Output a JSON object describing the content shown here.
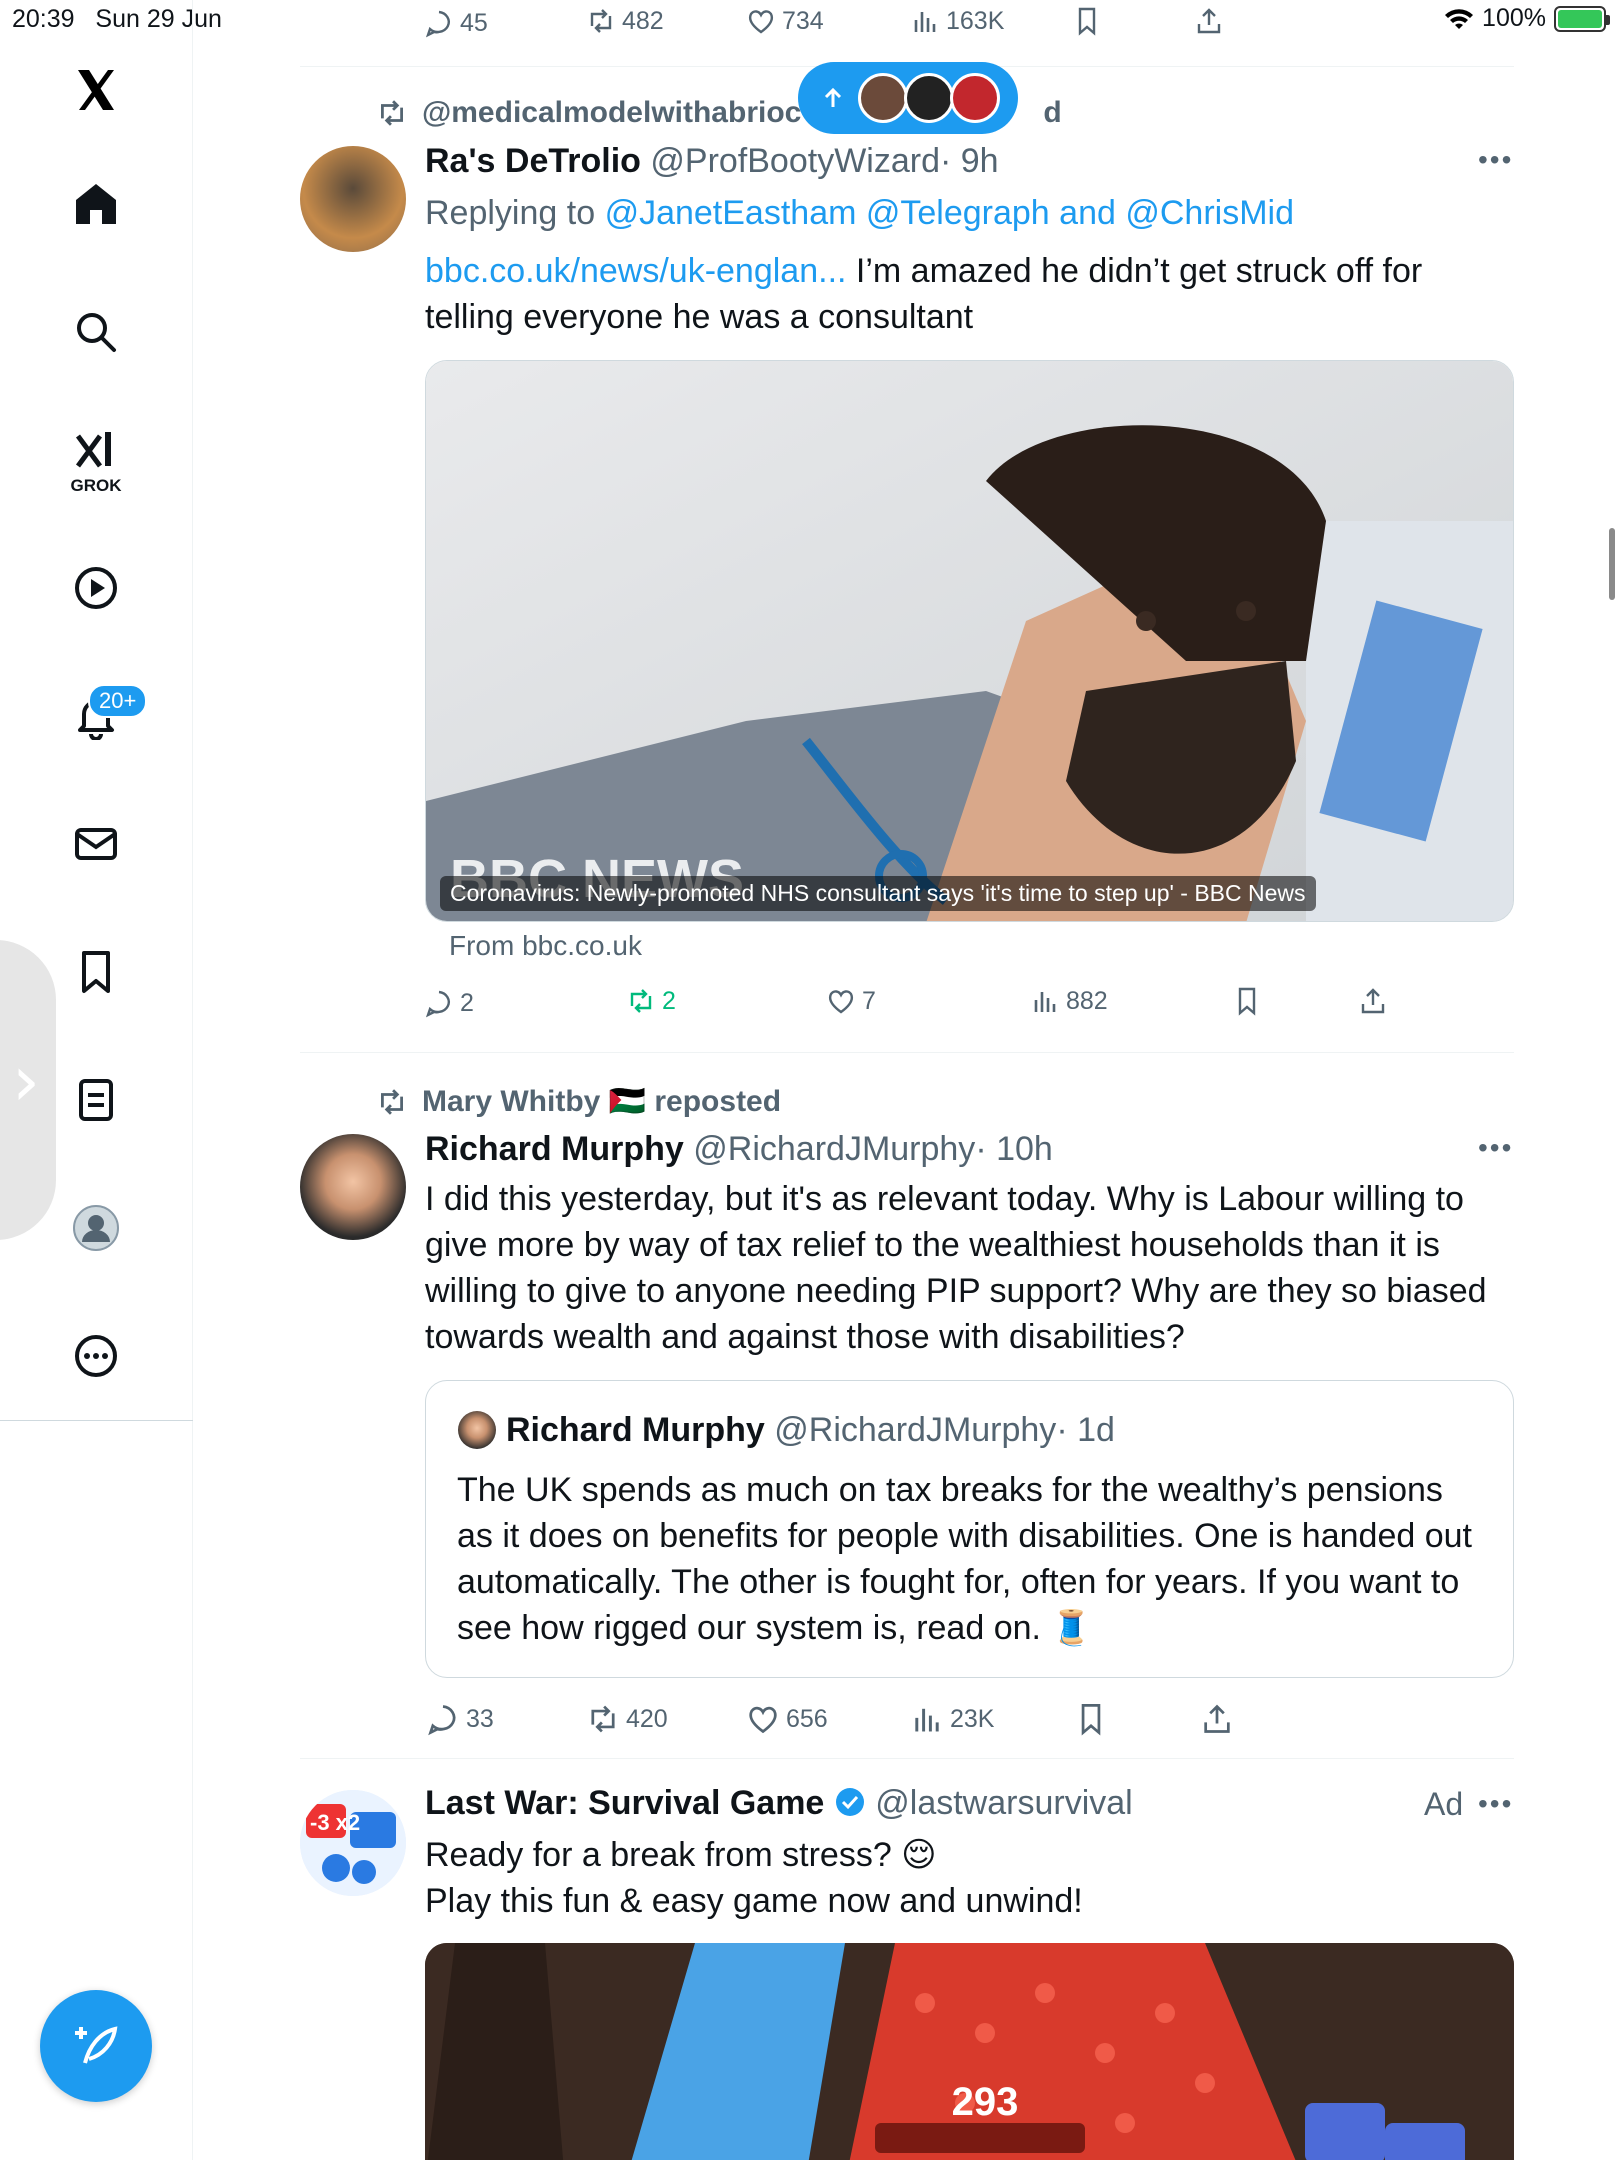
{
  "status_bar": {
    "time": "20:39",
    "date": "Sun 29 Jun",
    "battery": "100%"
  },
  "sidebar": {
    "grok_label": "GROK",
    "notification_badge": "20+"
  },
  "top_metrics": {
    "replies": "45",
    "reposts": "482",
    "likes": "734",
    "views": "163K"
  },
  "tweet1": {
    "reposted_by": "@medicalmodelwithabrioc",
    "reposted_tail": "d",
    "name": "Ra's DeTrolio",
    "handle": "@ProfBootyWizard",
    "time": "· 9h",
    "replying_prefix": "Replying to",
    "replying_to": "@JanetEastham @Telegraph and @ChrisMid",
    "link": "bbc.co.uk/news/uk-englan...",
    "text_line1": " I’m amazed he didn’t get struck off for",
    "text_line2": "telling everyone he was a consultant",
    "card_watermark": "BBC NEWS",
    "card_caption": "Coronavirus: Newly-promoted NHS consultant says 'it's time to step up' - BBC News",
    "card_from": "From bbc.co.uk",
    "metrics": {
      "replies": "2",
      "reposts": "2",
      "likes": "7",
      "views": "882"
    }
  },
  "tweet2": {
    "reposted_by": "Mary Whitby 🇵🇸 reposted",
    "name": "Richard Murphy",
    "handle": "@RichardJMurphy",
    "time": "· 10h",
    "text": [
      "I did this yesterday, but it's as relevant today. Why is Labour willing to",
      "give more by way of tax relief to the wealthiest households than it is",
      "willing to give to anyone needing PIP support? Why are they so biased",
      "towards wealth and against those with disabilities?"
    ],
    "quote": {
      "name": "Richard Murphy",
      "handle": "@RichardJMurphy",
      "time": "· 1d",
      "text": [
        "The UK spends as much on tax breaks for the wealthy’s pensions",
        "as it does on benefits for people with disabilities. One is handed out",
        "automatically. The other is fought for, often for years. If you want to",
        "see how rigged our system is, read on. 🧵"
      ]
    },
    "metrics": {
      "replies": "33",
      "reposts": "420",
      "likes": "656",
      "views": "23K"
    }
  },
  "tweet3": {
    "name": "Last War: Survival Game",
    "handle": "@lastwarsurvival",
    "ad_label": "Ad",
    "text_line1": "Ready for a break from stress? 😌",
    "text_line2": "Play this fun & easy game now and unwind!",
    "game_score": "293",
    "avatar_text": "-3 x2"
  },
  "colors": {
    "accent": "#1d9bf0",
    "repost_green": "#00ba7c",
    "muted": "#536471"
  }
}
